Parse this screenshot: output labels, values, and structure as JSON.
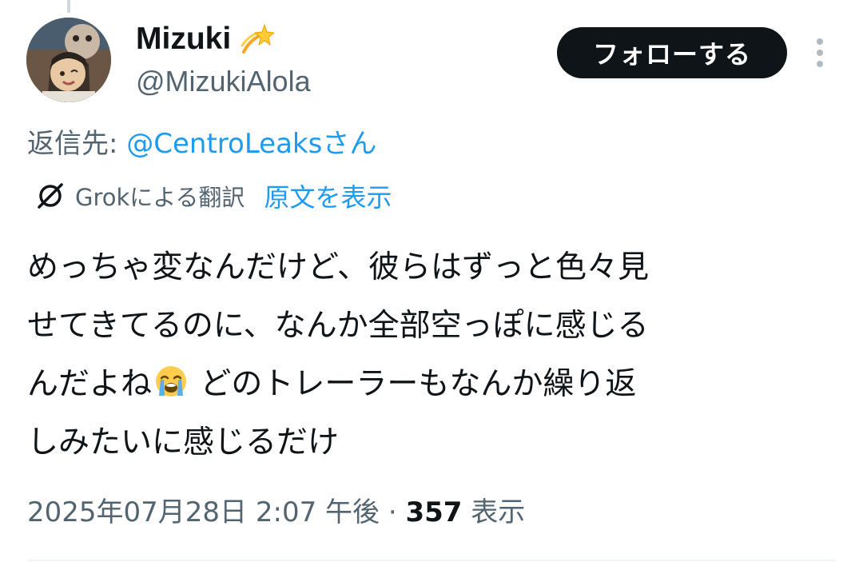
{
  "author": {
    "display_name": "Mizuki",
    "badge_icon": "dizzy-sparkle-emoji",
    "handle": "@MizukiAlola",
    "avatar_icon": "anime-character-avatar"
  },
  "actions": {
    "follow_label": "フォローする",
    "more_icon": "vertical-ellipsis-icon"
  },
  "reply": {
    "prefix": "返信先: ",
    "mention": "@CentroLeaks",
    "suffix": "さん"
  },
  "translation": {
    "icon": "grok-icon",
    "label": "Grokによる翻訳",
    "show_original": "原文を表示"
  },
  "tweet": {
    "line1": "めっちゃ変なんだけど、彼らはずっと色々見",
    "line2": "せてきてるのに、なんか全部空っぽに感じる",
    "line3_before": "んだよね",
    "line3_emoji": "loudly-crying-face-emoji",
    "line3_after": " どのトレーラーもなんか繰り返",
    "line4": "しみたいに感じるだけ"
  },
  "meta": {
    "timestamp": "2025年07月28日 2:07 午後",
    "separator": " · ",
    "views_count": "357",
    "views_label": " 表示"
  },
  "colors": {
    "text_primary": "#0f1419",
    "text_secondary": "#536471",
    "link": "#1d9bf0",
    "button_bg": "#0f1419"
  }
}
